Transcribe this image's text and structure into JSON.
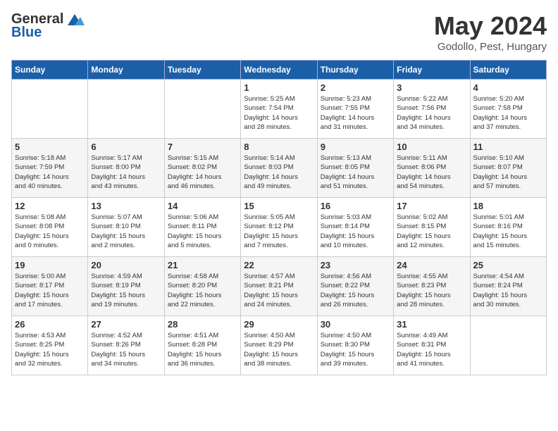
{
  "header": {
    "logo_general": "General",
    "logo_blue": "Blue",
    "month": "May 2024",
    "location": "Godollo, Pest, Hungary"
  },
  "weekdays": [
    "Sunday",
    "Monday",
    "Tuesday",
    "Wednesday",
    "Thursday",
    "Friday",
    "Saturday"
  ],
  "weeks": [
    [
      {
        "day": "",
        "info": ""
      },
      {
        "day": "",
        "info": ""
      },
      {
        "day": "",
        "info": ""
      },
      {
        "day": "1",
        "info": "Sunrise: 5:25 AM\nSunset: 7:54 PM\nDaylight: 14 hours\nand 28 minutes."
      },
      {
        "day": "2",
        "info": "Sunrise: 5:23 AM\nSunset: 7:55 PM\nDaylight: 14 hours\nand 31 minutes."
      },
      {
        "day": "3",
        "info": "Sunrise: 5:22 AM\nSunset: 7:56 PM\nDaylight: 14 hours\nand 34 minutes."
      },
      {
        "day": "4",
        "info": "Sunrise: 5:20 AM\nSunset: 7:58 PM\nDaylight: 14 hours\nand 37 minutes."
      }
    ],
    [
      {
        "day": "5",
        "info": "Sunrise: 5:18 AM\nSunset: 7:59 PM\nDaylight: 14 hours\nand 40 minutes."
      },
      {
        "day": "6",
        "info": "Sunrise: 5:17 AM\nSunset: 8:00 PM\nDaylight: 14 hours\nand 43 minutes."
      },
      {
        "day": "7",
        "info": "Sunrise: 5:15 AM\nSunset: 8:02 PM\nDaylight: 14 hours\nand 46 minutes."
      },
      {
        "day": "8",
        "info": "Sunrise: 5:14 AM\nSunset: 8:03 PM\nDaylight: 14 hours\nand 49 minutes."
      },
      {
        "day": "9",
        "info": "Sunrise: 5:13 AM\nSunset: 8:05 PM\nDaylight: 14 hours\nand 51 minutes."
      },
      {
        "day": "10",
        "info": "Sunrise: 5:11 AM\nSunset: 8:06 PM\nDaylight: 14 hours\nand 54 minutes."
      },
      {
        "day": "11",
        "info": "Sunrise: 5:10 AM\nSunset: 8:07 PM\nDaylight: 14 hours\nand 57 minutes."
      }
    ],
    [
      {
        "day": "12",
        "info": "Sunrise: 5:08 AM\nSunset: 8:08 PM\nDaylight: 15 hours\nand 0 minutes."
      },
      {
        "day": "13",
        "info": "Sunrise: 5:07 AM\nSunset: 8:10 PM\nDaylight: 15 hours\nand 2 minutes."
      },
      {
        "day": "14",
        "info": "Sunrise: 5:06 AM\nSunset: 8:11 PM\nDaylight: 15 hours\nand 5 minutes."
      },
      {
        "day": "15",
        "info": "Sunrise: 5:05 AM\nSunset: 8:12 PM\nDaylight: 15 hours\nand 7 minutes."
      },
      {
        "day": "16",
        "info": "Sunrise: 5:03 AM\nSunset: 8:14 PM\nDaylight: 15 hours\nand 10 minutes."
      },
      {
        "day": "17",
        "info": "Sunrise: 5:02 AM\nSunset: 8:15 PM\nDaylight: 15 hours\nand 12 minutes."
      },
      {
        "day": "18",
        "info": "Sunrise: 5:01 AM\nSunset: 8:16 PM\nDaylight: 15 hours\nand 15 minutes."
      }
    ],
    [
      {
        "day": "19",
        "info": "Sunrise: 5:00 AM\nSunset: 8:17 PM\nDaylight: 15 hours\nand 17 minutes."
      },
      {
        "day": "20",
        "info": "Sunrise: 4:59 AM\nSunset: 8:19 PM\nDaylight: 15 hours\nand 19 minutes."
      },
      {
        "day": "21",
        "info": "Sunrise: 4:58 AM\nSunset: 8:20 PM\nDaylight: 15 hours\nand 22 minutes."
      },
      {
        "day": "22",
        "info": "Sunrise: 4:57 AM\nSunset: 8:21 PM\nDaylight: 15 hours\nand 24 minutes."
      },
      {
        "day": "23",
        "info": "Sunrise: 4:56 AM\nSunset: 8:22 PM\nDaylight: 15 hours\nand 26 minutes."
      },
      {
        "day": "24",
        "info": "Sunrise: 4:55 AM\nSunset: 8:23 PM\nDaylight: 15 hours\nand 28 minutes."
      },
      {
        "day": "25",
        "info": "Sunrise: 4:54 AM\nSunset: 8:24 PM\nDaylight: 15 hours\nand 30 minutes."
      }
    ],
    [
      {
        "day": "26",
        "info": "Sunrise: 4:53 AM\nSunset: 8:25 PM\nDaylight: 15 hours\nand 32 minutes."
      },
      {
        "day": "27",
        "info": "Sunrise: 4:52 AM\nSunset: 8:26 PM\nDaylight: 15 hours\nand 34 minutes."
      },
      {
        "day": "28",
        "info": "Sunrise: 4:51 AM\nSunset: 8:28 PM\nDaylight: 15 hours\nand 36 minutes."
      },
      {
        "day": "29",
        "info": "Sunrise: 4:50 AM\nSunset: 8:29 PM\nDaylight: 15 hours\nand 38 minutes."
      },
      {
        "day": "30",
        "info": "Sunrise: 4:50 AM\nSunset: 8:30 PM\nDaylight: 15 hours\nand 39 minutes."
      },
      {
        "day": "31",
        "info": "Sunrise: 4:49 AM\nSunset: 8:31 PM\nDaylight: 15 hours\nand 41 minutes."
      },
      {
        "day": "",
        "info": ""
      }
    ]
  ]
}
